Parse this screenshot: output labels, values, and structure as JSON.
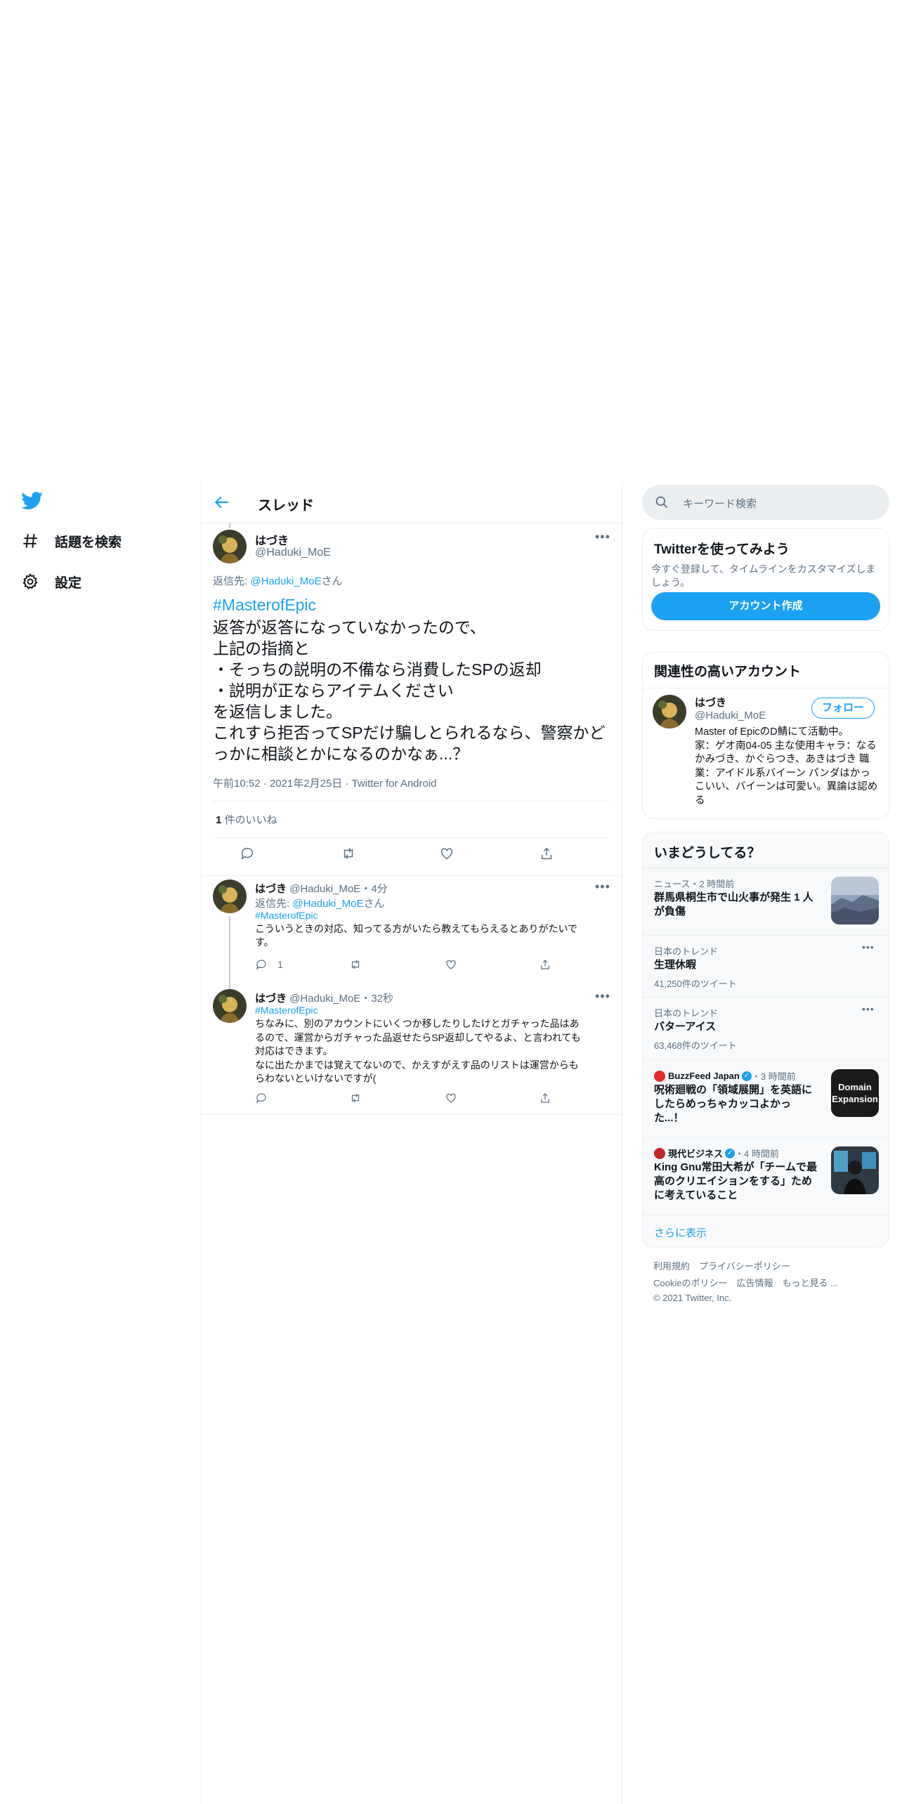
{
  "nav": {
    "explore_label": "話題を検索",
    "settings_label": "設定"
  },
  "header": {
    "title": "スレッド"
  },
  "focused_tweet": {
    "name": "はづき",
    "handle": "@Haduki_MoE",
    "reply_prefix": "返信先: ",
    "reply_handle": "@Haduki_MoE",
    "reply_suffix": "さん",
    "hashtag": "#MasterofEpic",
    "body": "返答が返答になっていなかったので、\n上記の指摘と\n・そっちの説明の不備なら消費したSPの返却\n・説明が正ならアイテムください\nを返信しました。\nこれすら拒否ってSPだけ騙しとられるなら、警察かどっかに相談とかになるのかなぁ...？",
    "time": "午前10:52",
    "date": "2021年2月25日",
    "source": "Twitter for Android",
    "like_count": "1",
    "like_label": " 件のいいね"
  },
  "replies": [
    {
      "name": "はづき",
      "handle": "@Haduki_MoE",
      "age": "4分",
      "reply_prefix": "返信先: ",
      "reply_handle": "@Haduki_MoE",
      "reply_suffix": "さん",
      "hashtag": "#MasterofEpic",
      "body": "こういうときの対応、知ってる方がいたら教えてもらえるとありがたいで\nす。",
      "reply_count": "1"
    },
    {
      "name": "はづき",
      "handle": "@Haduki_MoE",
      "age": "32秒",
      "hashtag": "#MasterofEpic",
      "body": "ちなみに、別のアカウントにいくつか移したりしたけとガチャった品はあ\nるので、運営からガチャった品返せたらSP返却してやるよ、と言われても\n対応はできます。\nなに出たかまでは覚えてないので、かえすがえす品のリストは運営からも\nらわないといけないですが("
    }
  ],
  "search": {
    "placeholder": "キーワード検索"
  },
  "signup": {
    "title": "Twitterを使ってみよう",
    "desc": "今すぐ登録して、タイムラインをカスタマイズしましょう。",
    "button": "アカウント作成"
  },
  "related": {
    "title": "関連性の高いアカウント",
    "name": "はづき",
    "handle": "@Haduki_MoE",
    "follow": "フォロー",
    "bio": "Master of EpicのD鯖にて活動中。\n家：ゲオ南04-05 主な使用キャラ：なるかみづき、かぐらつき、あきはづき 職業：アイドル系バイーン パンダはかっこいい、バイーンは可愛い。異論は認める"
  },
  "trends": {
    "title": "いまどうしてる？",
    "items": [
      {
        "category": "ニュース・2 時間前",
        "title": "群馬県桐生市で山火事が発生 1 人\nが負傷"
      },
      {
        "category": "日本のトレンド",
        "title": "生理休暇",
        "count": "41,250件のツイート"
      },
      {
        "category": "日本のトレンド",
        "title": "バターアイス",
        "count": "63,468件のツイート"
      },
      {
        "source": "BuzzFeed Japan",
        "age": "・3 時間前",
        "title": "呪術廻戦の「領域展開」を英語に\nしたらめっちゃカッコよかっ\nた...！",
        "thumb_text": "Domain\nExpansion"
      },
      {
        "source": "現代ビジネス",
        "age": "・4 時間前",
        "title": "King Gnu常田大希が「チームで最\n高のクリエイションをする」ため\nに考えていること"
      }
    ],
    "show_more": "さらに表示"
  },
  "footer": {
    "line1": "利用規約　プライバシーポリシー",
    "line2": "Cookieのポリシー　広告情報　もっと見る ...",
    "line3": "© 2021 Twitter, Inc."
  },
  "colors": {
    "accent": "#1da1f2",
    "secondary_text": "#5b7083",
    "border": "#ebeef0"
  }
}
